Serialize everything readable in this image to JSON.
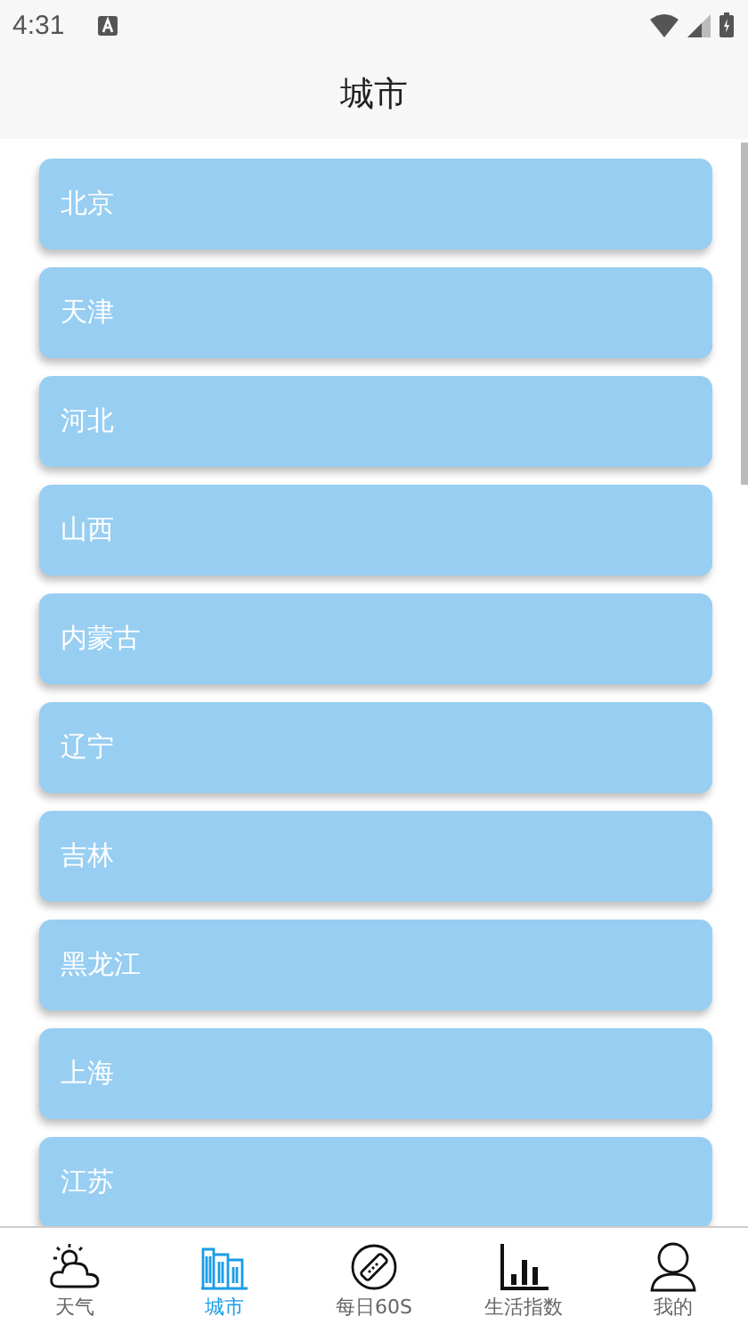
{
  "status_bar": {
    "time": "4:31"
  },
  "header": {
    "title": "城市"
  },
  "cities": [
    {
      "name": "北京"
    },
    {
      "name": "天津"
    },
    {
      "name": "河北"
    },
    {
      "name": "山西"
    },
    {
      "name": "内蒙古"
    },
    {
      "name": "辽宁"
    },
    {
      "name": "吉林"
    },
    {
      "name": "黑龙江"
    },
    {
      "name": "上海"
    },
    {
      "name": "江苏"
    }
  ],
  "tabs": [
    {
      "label": "天气",
      "selected": false
    },
    {
      "label": "城市",
      "selected": true
    },
    {
      "label": "每日60S",
      "selected": false
    },
    {
      "label": "生活指数",
      "selected": false
    },
    {
      "label": "我的",
      "selected": false
    }
  ]
}
